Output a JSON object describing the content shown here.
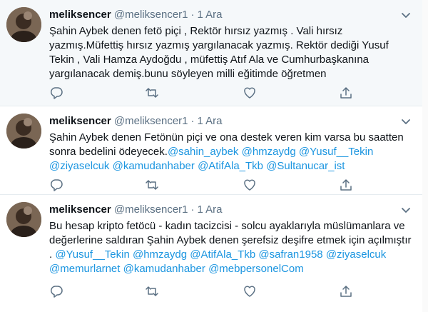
{
  "tweets": [
    {
      "name": "meliksencer",
      "handle": "@meliksencer1",
      "separator": "·",
      "time": "1 Ara",
      "text_parts": [
        {
          "t": "Şahin Aybek denen fetö piçi , Rektör hırsız yazmış . Vali hırsız yazmış.Müfettiş hırsız yazmış yargılanacak yazmış. Rektör dediği Yusuf Tekin , Vali Hamza Aydoğdu , müfettiş Atıf Ala ve Cumhurbaşkanına yargılanacak demiş.bunu söyleyen milli eğitimde öğretmen",
          "m": false
        }
      ]
    },
    {
      "name": "meliksencer",
      "handle": "@meliksencer1",
      "separator": "·",
      "time": "1 Ara",
      "text_parts": [
        {
          "t": "Şahin Aybek denen Fetönün piçi ve ona destek veren kim varsa bu saatten sonra bedelini ödeyecek.",
          "m": false
        },
        {
          "t": "@sahin_aybek",
          "m": true
        },
        {
          "t": " ",
          "m": false
        },
        {
          "t": "@hmzaydg",
          "m": true
        },
        {
          "t": " ",
          "m": false
        },
        {
          "t": "@Yusuf__Tekin",
          "m": true
        },
        {
          "t": " ",
          "m": false
        },
        {
          "t": "@ziyaselcuk",
          "m": true
        },
        {
          "t": " ",
          "m": false
        },
        {
          "t": "@kamudanhaber",
          "m": true
        },
        {
          "t": " ",
          "m": false
        },
        {
          "t": "@AtifAla_Tkb",
          "m": true
        },
        {
          "t": " ",
          "m": false
        },
        {
          "t": "@Sultanucar_ist",
          "m": true
        }
      ]
    },
    {
      "name": "meliksencer",
      "handle": "@meliksencer1",
      "separator": "·",
      "time": "1 Ara",
      "text_parts": [
        {
          "t": "Bu hesap kripto fetöcü - kadın tacizcisi - solcu ayaklarıyla müslümanlara ve değerlerine saldıran Şahin Aybek denen şerefsiz deşifre etmek için açılmıştır . ",
          "m": false
        },
        {
          "t": "@Yusuf__Tekin",
          "m": true
        },
        {
          "t": " ",
          "m": false
        },
        {
          "t": "@hmzaydg",
          "m": true
        },
        {
          "t": " ",
          "m": false
        },
        {
          "t": "@AtifAla_Tkb",
          "m": true
        },
        {
          "t": " ",
          "m": false
        },
        {
          "t": "@safran1958",
          "m": true
        },
        {
          "t": " ",
          "m": false
        },
        {
          "t": "@ziyaselcuk",
          "m": true
        },
        {
          "t": " ",
          "m": false
        },
        {
          "t": "@memurlarnet",
          "m": true
        },
        {
          "t": " ",
          "m": false
        },
        {
          "t": "@kamudanhaber",
          "m": true
        },
        {
          "t": " ",
          "m": false
        },
        {
          "t": "@mebpersonelCom",
          "m": true
        }
      ]
    }
  ],
  "icons": [
    "reply-icon",
    "retweet-icon",
    "like-icon",
    "share-icon",
    "caret-down-icon"
  ],
  "colors": {
    "text": "#0f1419",
    "muted": "#5b7083",
    "link": "#1b95e0",
    "highlight": "#f5f8fa",
    "border": "#e6ecf0"
  }
}
